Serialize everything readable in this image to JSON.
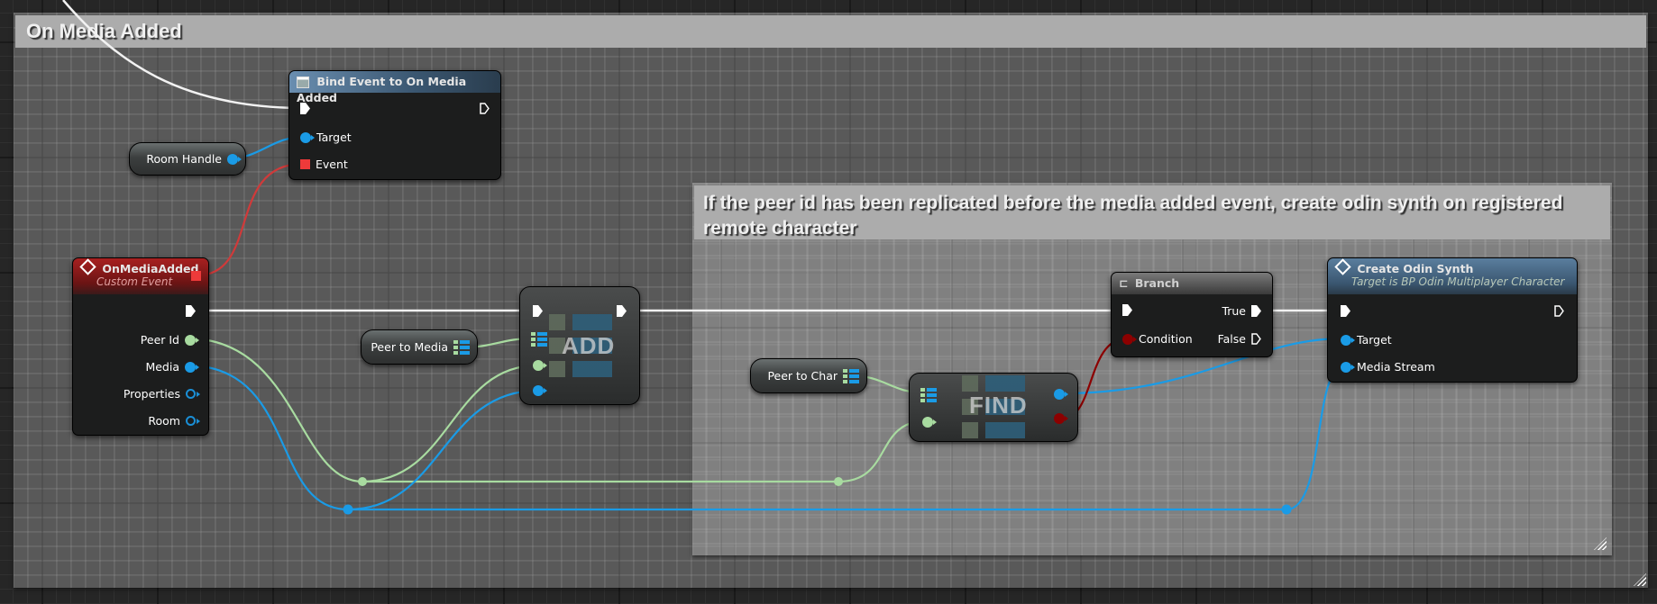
{
  "outer_comment": {
    "title": "On Media Added"
  },
  "inner_comment": {
    "title": "If the peer id has been replicated before the media added event, create odin synth on registered remote character"
  },
  "nodes": {
    "bind_event": {
      "title": "Bind Event to On Media Added",
      "icon": "event-dispatcher-icon",
      "pins": {
        "target": "Target",
        "event": "Event"
      }
    },
    "room_handle": {
      "label": "Room Handle"
    },
    "on_media_added": {
      "title": "OnMediaAdded",
      "subtitle": "Custom Event",
      "icon": "event-diamond-icon",
      "pins": {
        "peer_id": "Peer Id",
        "media": "Media",
        "properties": "Properties",
        "room": "Room"
      }
    },
    "peer_to_media": {
      "label": "Peer to Media"
    },
    "add": {
      "label": "ADD"
    },
    "peer_to_char": {
      "label": "Peer to Char"
    },
    "find": {
      "label": "FIND"
    },
    "branch": {
      "title": "Branch",
      "icon": "branch-icon",
      "pins": {
        "condition": "Condition",
        "true": "True",
        "false": "False"
      }
    },
    "create_odin_synth": {
      "title": "Create Odin Synth",
      "subtitle": "Target is BP Odin Multiplayer Character",
      "icon": "function-diamond-icon",
      "pins": {
        "target": "Target",
        "media_stream": "Media Stream"
      }
    }
  },
  "colors": {
    "exec": "#ffffff",
    "object_pin": "#1a9be6",
    "integer_pin": "#a8dba0",
    "delegate_pin": "#ee3a3a",
    "bool_pin": "#8c0000",
    "event_header": "#8a1a1a",
    "function_header": "#5a7a96"
  }
}
